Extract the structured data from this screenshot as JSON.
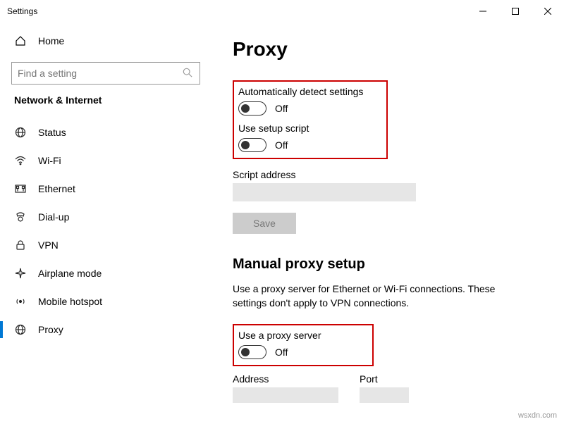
{
  "window": {
    "title": "Settings"
  },
  "sidebar": {
    "home": "Home",
    "search_placeholder": "Find a setting",
    "category": "Network & Internet",
    "items": [
      {
        "label": "Status"
      },
      {
        "label": "Wi-Fi"
      },
      {
        "label": "Ethernet"
      },
      {
        "label": "Dial-up"
      },
      {
        "label": "VPN"
      },
      {
        "label": "Airplane mode"
      },
      {
        "label": "Mobile hotspot"
      },
      {
        "label": "Proxy"
      }
    ]
  },
  "page": {
    "title": "Proxy",
    "auto_detect_label": "Automatically detect settings",
    "auto_detect_state": "Off",
    "setup_script_label": "Use setup script",
    "setup_script_state": "Off",
    "script_address_label": "Script address",
    "script_address_value": "",
    "save_label": "Save",
    "manual_title": "Manual proxy setup",
    "manual_desc": "Use a proxy server for Ethernet or Wi-Fi connections. These settings don't apply to VPN connections.",
    "use_proxy_label": "Use a proxy server",
    "use_proxy_state": "Off",
    "address_label": "Address",
    "address_value": "",
    "port_label": "Port",
    "port_value": ""
  },
  "watermark": "wsxdn.com"
}
